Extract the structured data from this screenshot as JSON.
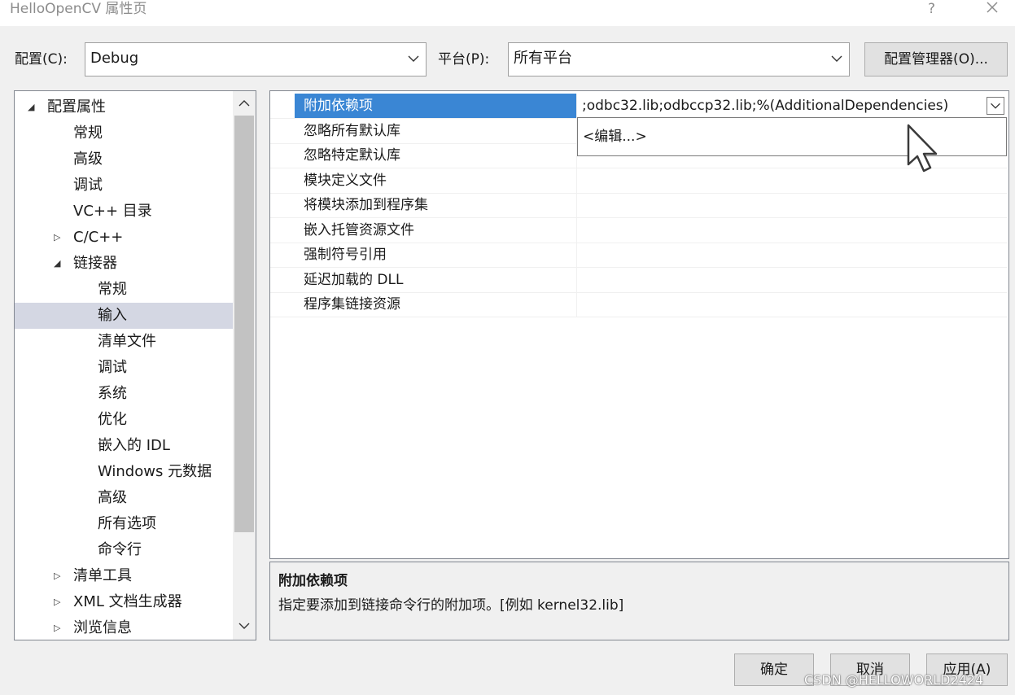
{
  "window": {
    "title": "HelloOpenCV 属性页",
    "help": "?"
  },
  "config": {
    "label": "配置(C):",
    "value": "Debug"
  },
  "platform": {
    "label": "平台(P):",
    "value": "所有平台"
  },
  "config_manager_label": "配置管理器(O)...",
  "tree": {
    "items": [
      {
        "label": "配置属性",
        "arrow": "◢",
        "expanded": true
      },
      {
        "label": "常规"
      },
      {
        "label": "高级"
      },
      {
        "label": "调试"
      },
      {
        "label": "VC++ 目录"
      },
      {
        "label": "C/C++",
        "arrow": "▷"
      },
      {
        "label": "链接器",
        "arrow": "◢",
        "expanded": true
      },
      {
        "label": "常规"
      },
      {
        "label": "输入",
        "selected": true
      },
      {
        "label": "清单文件"
      },
      {
        "label": "调试"
      },
      {
        "label": "系统"
      },
      {
        "label": "优化"
      },
      {
        "label": "嵌入的 IDL"
      },
      {
        "label": "Windows 元数据"
      },
      {
        "label": "高级"
      },
      {
        "label": "所有选项"
      },
      {
        "label": "命令行"
      },
      {
        "label": "清单工具",
        "arrow": "▷"
      },
      {
        "label": "XML 文档生成器",
        "arrow": "▷"
      },
      {
        "label": "浏览信息",
        "arrow": "▷"
      }
    ]
  },
  "properties": {
    "rows": [
      {
        "name": "附加依赖项",
        "value": ";odbc32.lib;odbccp32.lib;%(AdditionalDependencies)"
      },
      {
        "name": "忽略所有默认库",
        "value": ""
      },
      {
        "name": "忽略特定默认库",
        "value": ""
      },
      {
        "name": "模块定义文件",
        "value": ""
      },
      {
        "name": "将模块添加到程序集",
        "value": ""
      },
      {
        "name": "嵌入托管资源文件",
        "value": ""
      },
      {
        "name": "强制符号引用",
        "value": ""
      },
      {
        "name": "延迟加载的 DLL",
        "value": ""
      },
      {
        "name": "程序集链接资源",
        "value": ""
      }
    ],
    "dropdown_item": "<编辑...>"
  },
  "description": {
    "title": "附加依赖项",
    "text": "指定要添加到链接命令行的附加项。[例如 kernel32.lib]"
  },
  "buttons": {
    "ok": "确定",
    "cancel": "取消",
    "apply": "应用(A)"
  },
  "watermark": "CSDN @HELLOWORLD2424",
  "colors": {
    "selection": "#3a86d4",
    "tree_selection": "#d4d7e3",
    "background": "#f0f0f0"
  }
}
